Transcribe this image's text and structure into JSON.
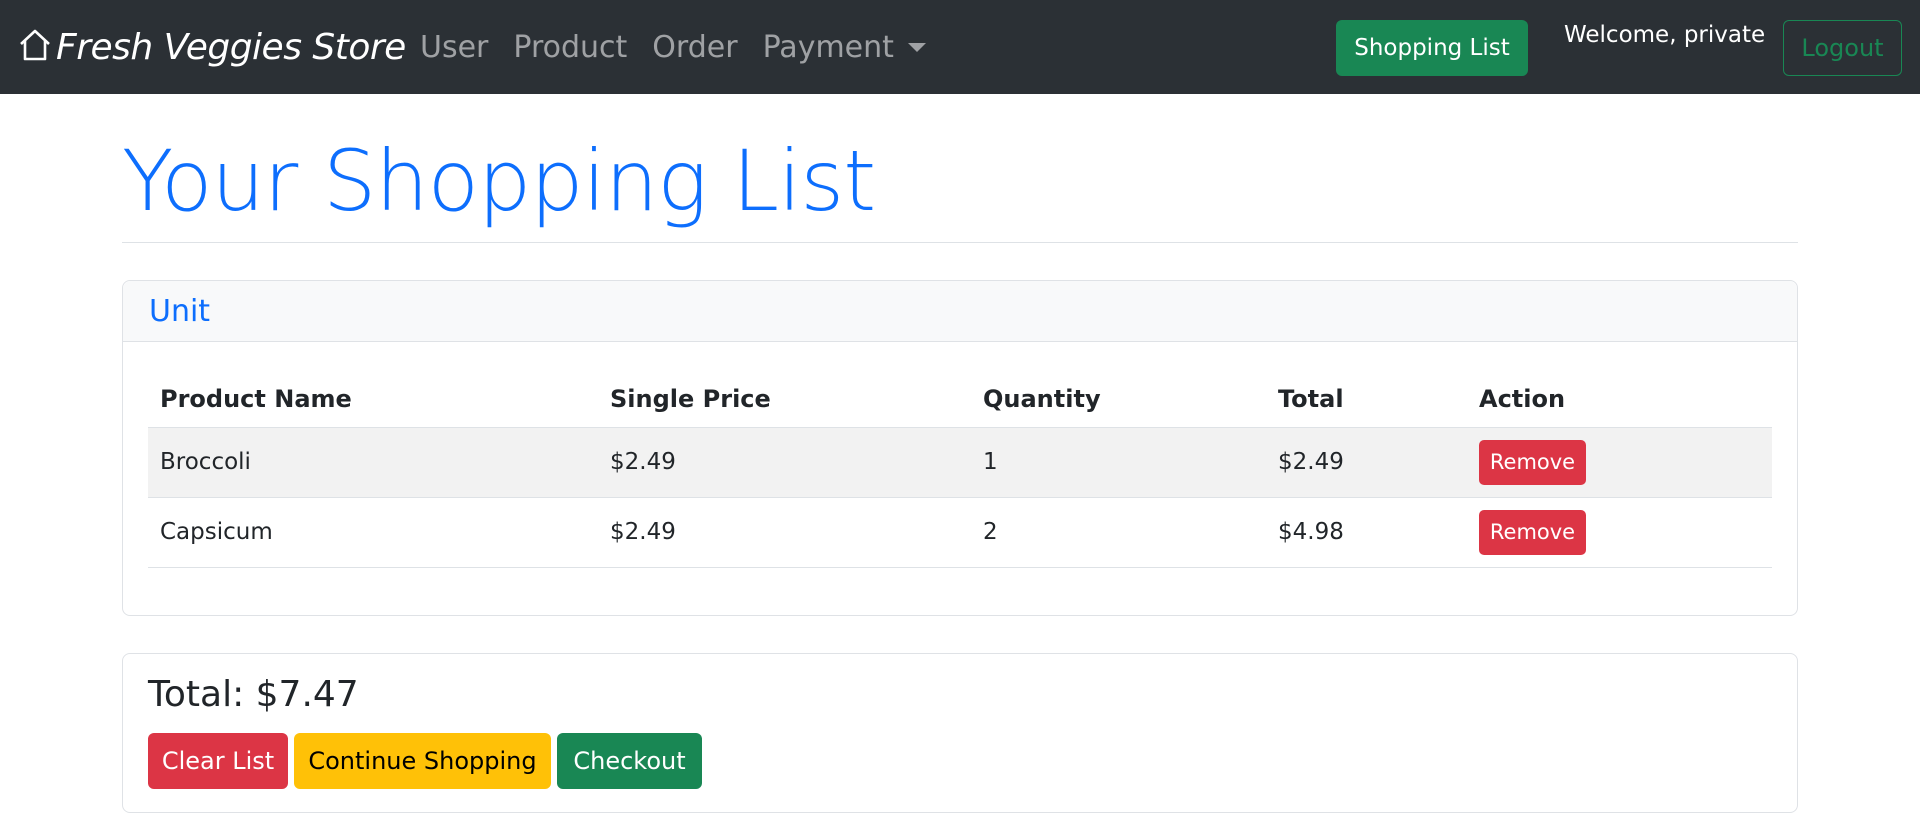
{
  "navbar": {
    "brand": "Fresh Veggies Store",
    "brand_icon": "house-icon",
    "links": [
      "User",
      "Product",
      "Order",
      "Payment"
    ],
    "shopping_list_button": "Shopping List",
    "welcome": "Welcome, private",
    "logout_button": "Logout"
  },
  "page": {
    "title": "Your Shopping List"
  },
  "unit_card": {
    "header": "Unit",
    "columns": [
      "Product Name",
      "Single Price",
      "Quantity",
      "Total",
      "Action"
    ],
    "rows": [
      {
        "name": "Broccoli",
        "price": "$2.49",
        "qty": "1",
        "total": "$2.49",
        "action": "Remove"
      },
      {
        "name": "Capsicum",
        "price": "$2.49",
        "qty": "2",
        "total": "$4.98",
        "action": "Remove"
      }
    ]
  },
  "summary": {
    "total": "Total: $7.47",
    "clear_button": "Clear List",
    "continue_button": "Continue Shopping",
    "checkout_button": "Checkout"
  },
  "colors": {
    "navbar_bg": "#2b3035",
    "primary": "#0d6efd",
    "success": "#198754",
    "danger": "#dc3545",
    "warning": "#ffc107"
  }
}
